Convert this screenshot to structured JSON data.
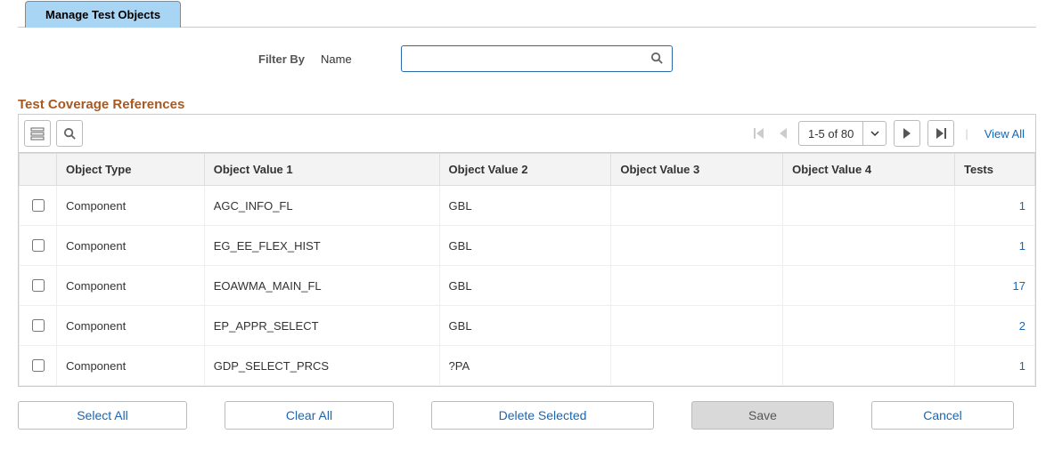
{
  "tab": {
    "label": "Manage Test Objects"
  },
  "filter": {
    "label": "Filter By",
    "type": "Name",
    "value": ""
  },
  "section_title": "Test Coverage References",
  "pager": {
    "range": "1-5 of 80",
    "view_all": "View All"
  },
  "columns": {
    "object_type": "Object Type",
    "object_value_1": "Object Value 1",
    "object_value_2": "Object Value 2",
    "object_value_3": "Object Value 3",
    "object_value_4": "Object Value 4",
    "tests": "Tests"
  },
  "rows": [
    {
      "object_type": "Component",
      "v1": "AGC_INFO_FL",
      "v2": "GBL",
      "v3": "",
      "v4": "",
      "tests": "1"
    },
    {
      "object_type": "Component",
      "v1": "EG_EE_FLEX_HIST",
      "v2": "GBL",
      "v3": "",
      "v4": "",
      "tests": "1"
    },
    {
      "object_type": "Component",
      "v1": "EOAWMA_MAIN_FL",
      "v2": "GBL",
      "v3": "",
      "v4": "",
      "tests": "17"
    },
    {
      "object_type": "Component",
      "v1": "EP_APPR_SELECT",
      "v2": "GBL",
      "v3": "",
      "v4": "",
      "tests": "2"
    },
    {
      "object_type": "Component",
      "v1": "GDP_SELECT_PRCS",
      "v2": "?PA",
      "v3": "",
      "v4": "",
      "tests": "1"
    }
  ],
  "buttons": {
    "select_all": "Select All",
    "clear_all": "Clear All",
    "delete_selected": "Delete Selected",
    "save": "Save",
    "cancel": "Cancel"
  }
}
